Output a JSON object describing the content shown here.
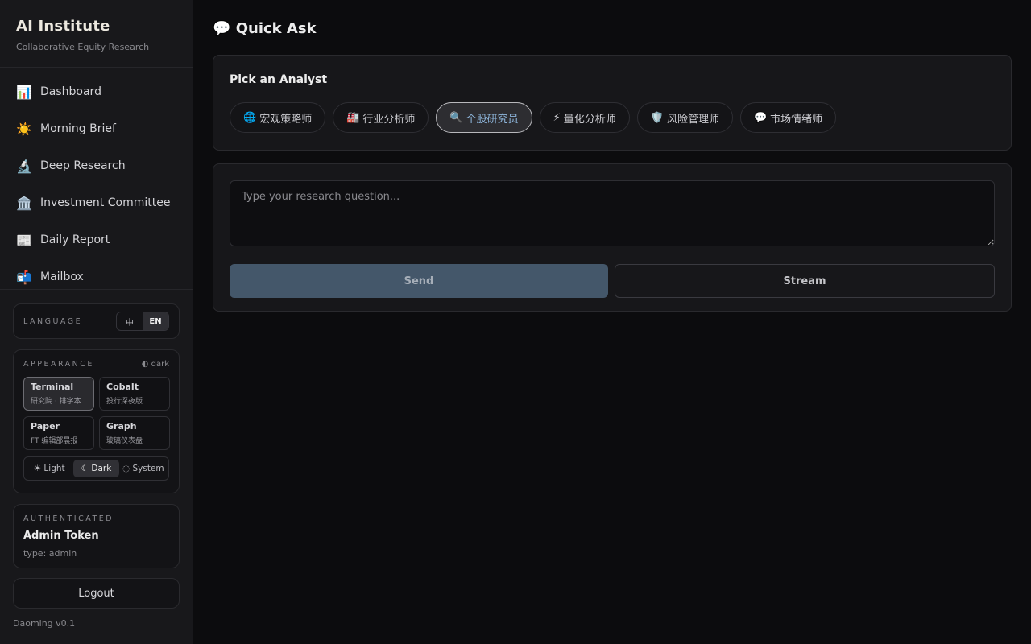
{
  "brand": {
    "title": "AI Institute",
    "subtitle": "Collaborative Equity Research"
  },
  "nav": [
    {
      "icon": "📊",
      "label": "Dashboard"
    },
    {
      "icon": "☀️",
      "label": "Morning Brief"
    },
    {
      "icon": "🔬",
      "label": "Deep Research"
    },
    {
      "icon": "🏛️",
      "label": "Investment Committee"
    },
    {
      "icon": "📰",
      "label": "Daily Report"
    },
    {
      "icon": "📬",
      "label": "Mailbox"
    }
  ],
  "language": {
    "label": "LANGUAGE",
    "options": [
      "中",
      "EN"
    ],
    "selected": "EN"
  },
  "appearance": {
    "label": "APPEARANCE",
    "mode_tag": "◐ dark",
    "themes": [
      {
        "name": "Terminal",
        "desc": "研究院 · 排字本"
      },
      {
        "name": "Cobalt",
        "desc": "投行深夜版"
      },
      {
        "name": "Paper",
        "desc": "FT 编辑部晨报"
      },
      {
        "name": "Graph",
        "desc": "玻璃仪表盘"
      }
    ],
    "selected_theme": "Terminal",
    "modes": [
      "☀ Light",
      "☾ Dark",
      "◌ System"
    ],
    "selected_mode": "☾ Dark"
  },
  "auth": {
    "label": "AUTHENTICATED",
    "name": "Admin Token",
    "type": "type: admin"
  },
  "logout_label": "Logout",
  "version": "Daoming v0.1",
  "main": {
    "title_icon": "💬",
    "title": "Quick Ask",
    "analyst_title": "Pick an Analyst",
    "analysts": [
      {
        "icon": "🌐",
        "label": "宏观策略师"
      },
      {
        "icon": "🏭",
        "label": "行业分析师"
      },
      {
        "icon": "🔍",
        "label": "个股研究员"
      },
      {
        "icon": "⚡",
        "label": "量化分析师"
      },
      {
        "icon": "🛡️",
        "label": "风险管理师"
      },
      {
        "icon": "💬",
        "label": "市场情绪师"
      }
    ],
    "selected_analyst": "个股研究员",
    "question_placeholder": "Type your research question...",
    "question_value": "",
    "send_label": "Send",
    "stream_label": "Stream"
  }
}
